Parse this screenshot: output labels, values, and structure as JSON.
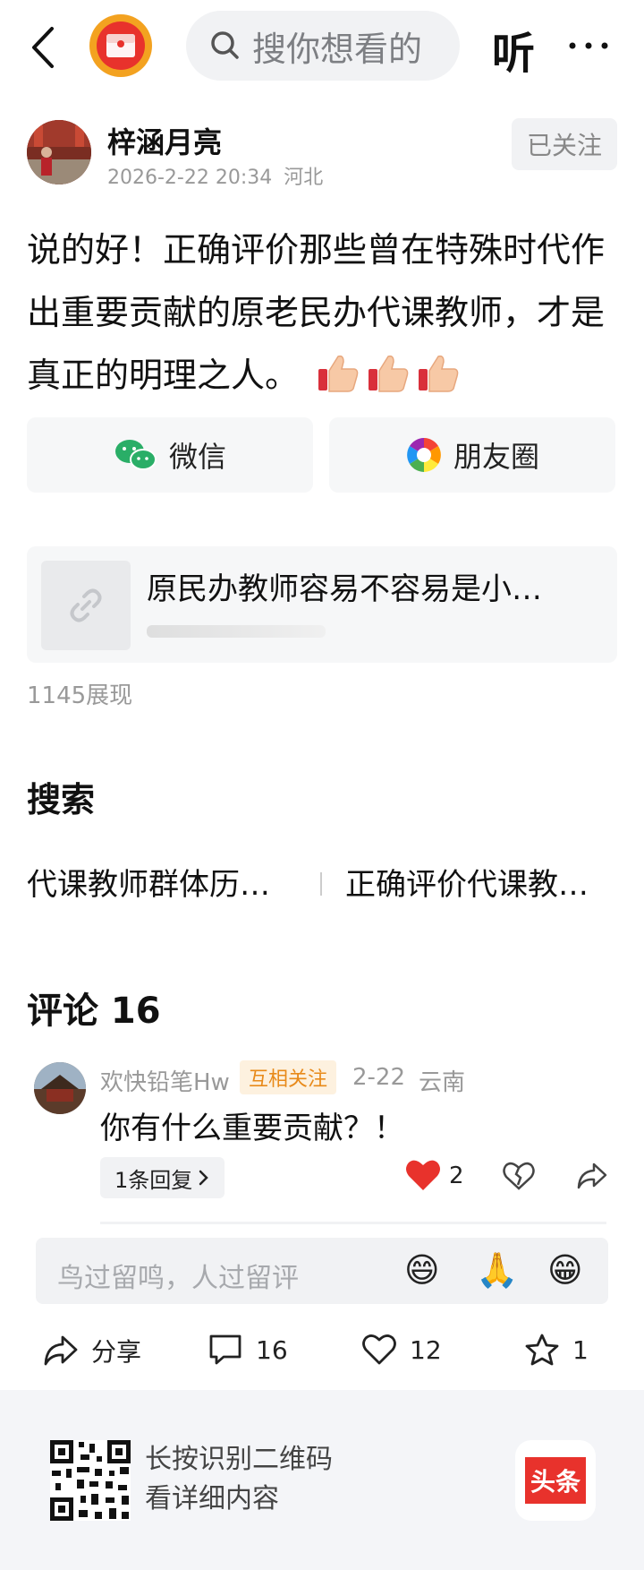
{
  "header": {
    "search_placeholder": "搜你想看的",
    "listen_label": "听"
  },
  "author": {
    "name": "梓涵月亮",
    "datetime": "2026-2-22 20:34",
    "location": "河北",
    "follow_label": "已关注"
  },
  "post": {
    "text": "说的好！正确评价那些曾在特殊时代作出重要贡献的原老民办代课教师，才是真正的明理之人。"
  },
  "share": {
    "wechat_label": "微信",
    "moments_label": "朋友圈"
  },
  "link_card": {
    "title": "原民办教师容易不容易是小…"
  },
  "views": "1145展现",
  "search_section": {
    "title": "搜索",
    "suggestions": [
      "代课教师群体历…",
      "正确评价代课教…"
    ]
  },
  "comments": {
    "title": "评论 16",
    "items": [
      {
        "user": "欢快铅笔Hw",
        "badge": "互相关注",
        "date": "2-22",
        "location": "云南",
        "text": "你有什么重要贡献？！",
        "reply_label": "1条回复",
        "likes": "2"
      }
    ]
  },
  "input": {
    "placeholder": "鸟过留鸣，人过留评",
    "emojis": [
      "😄",
      "🙏",
      "😁"
    ]
  },
  "actions": {
    "share_label": "分享",
    "comment_count": "16",
    "like_count": "12",
    "favorite_count": "1"
  },
  "footer": {
    "line1": "长按识别二维码",
    "line2": "看详细内容",
    "brand": "头条"
  },
  "colors": {
    "accent_red": "#e8322c",
    "wechat_green": "#2aae67",
    "badge_orange": "#e88a1a"
  }
}
